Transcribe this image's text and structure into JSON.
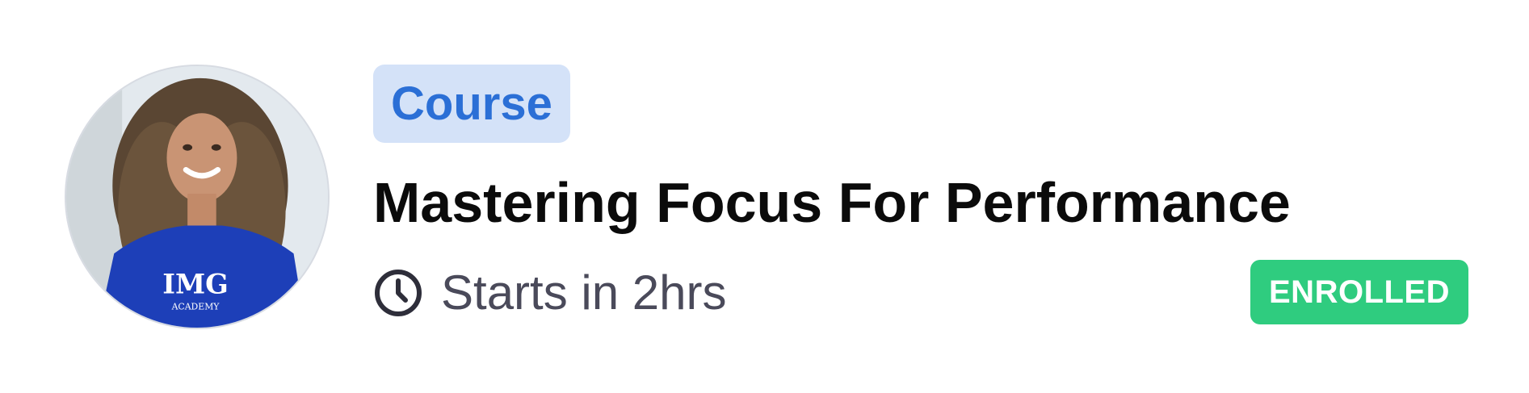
{
  "card": {
    "type_label": "Course",
    "title": "Mastering Focus For Performance",
    "start_text": "Starts in 2hrs",
    "status": "ENROLLED",
    "avatar_shirt_text": "IMG",
    "avatar_shirt_subtext": "ACADEMY"
  },
  "icons": {
    "clock": "clock-icon",
    "avatar": "instructor-avatar"
  },
  "colors": {
    "type_badge_bg": "#d4e2f8",
    "type_badge_text": "#2b6fd6",
    "title_text": "#0b0b0b",
    "meta_text": "#4a4a5a",
    "status_bg": "#2fcc7f",
    "status_text": "#ffffff"
  }
}
